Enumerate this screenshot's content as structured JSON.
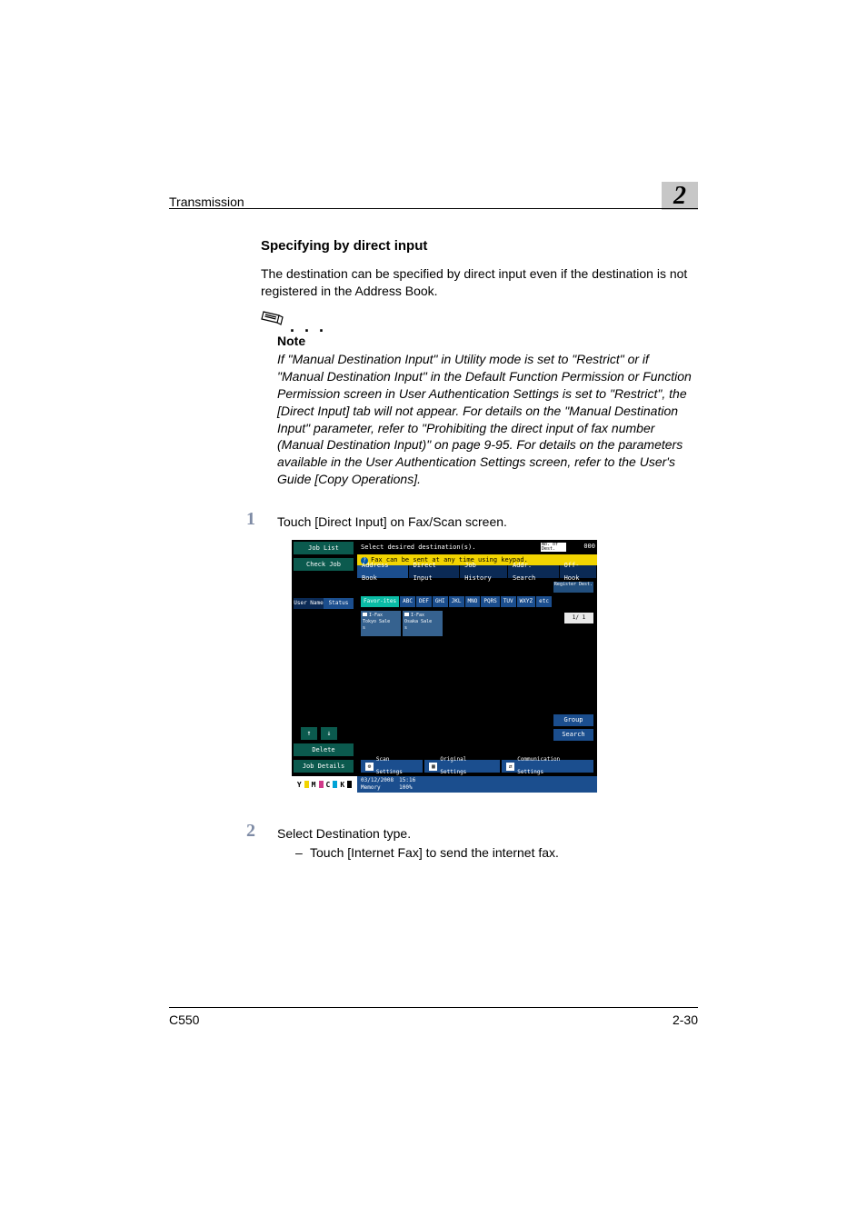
{
  "header": {
    "title": "Transmission",
    "chapter": "2"
  },
  "section": {
    "heading": "Specifying by direct input"
  },
  "paragraphs": {
    "intro": "The destination can be specified by direct input even if the destination is not registered in the Address Book."
  },
  "note": {
    "label": "Note",
    "dots": ". . .",
    "body": "If \"Manual Destination Input\" in Utility mode is set to \"Restrict\" or if \"Manual Destination Input\" in the Default Function Permission or Function Permission screen in User Authentication Settings is set to \"Restrict\", the [Direct Input] tab will not appear. For details on the \"Manual Destination Input\" parameter, refer to \"Prohibiting the direct input of fax number (Manual Destination Input)\" on page 9-95. For details on the parameters available in the User Authentication Settings screen, refer to the User's Guide [Copy Operations]."
  },
  "steps": {
    "s1": {
      "num": "1",
      "text": "Touch [Direct Input] on Fax/Scan screen."
    },
    "s2": {
      "num": "2",
      "text": "Select Destination type.",
      "bullet_dash": "–",
      "bullet_text": "Touch [Internet Fax] to send the internet fax."
    }
  },
  "screenshot": {
    "left": {
      "job_list": "Job List",
      "check_job": "Check Job",
      "seg_user": "User Name",
      "seg_status": "Status",
      "delete": "Delete",
      "job_details": "Job Details",
      "arrow_up": "↑",
      "arrow_down": "↓",
      "flags": {
        "y": "Y",
        "m": "M",
        "c": "C",
        "k": "K"
      }
    },
    "main": {
      "top_msg": "Select desired destination(s).",
      "doc_label": "No. of Dest.",
      "doc_count": "000",
      "yellow_hint": "Fax can be sent at any time using keypad.",
      "tabs": {
        "address_book": "Address Book",
        "direct_input": "Direct Input",
        "job_history": "Job History",
        "addr_search": "Addr. Search",
        "off_hook": "Off-Hook"
      },
      "register_btn": "Register Dest.",
      "alpha": [
        "Favor-ites",
        "ABC",
        "DEF",
        "GHI",
        "JKL",
        "MNO",
        "PQRS",
        "TUV",
        "WXYZ",
        "etc"
      ],
      "cards": [
        {
          "type": "I-Fax",
          "name": "Tokyo Sale",
          "suffix": "s"
        },
        {
          "type": "I-Fax",
          "name": "Osaka Sale",
          "suffix": "s"
        }
      ],
      "page_indicator": "1/ 1",
      "group_btn": "Group",
      "search_btn": "Search",
      "bottom": {
        "scan_settings": "Scan Settings",
        "original_settings": "Original Settings",
        "comm_settings": "Communication Settings",
        "scan_icon": "⚙",
        "original_icon": "▦",
        "comm_icon": "⇄"
      },
      "datebar": {
        "date": "03/12/2008",
        "time": "15:16",
        "mem_label": "Memory",
        "mem_value": "100%"
      }
    }
  },
  "footer": {
    "left": "C550",
    "right": "2-30"
  }
}
